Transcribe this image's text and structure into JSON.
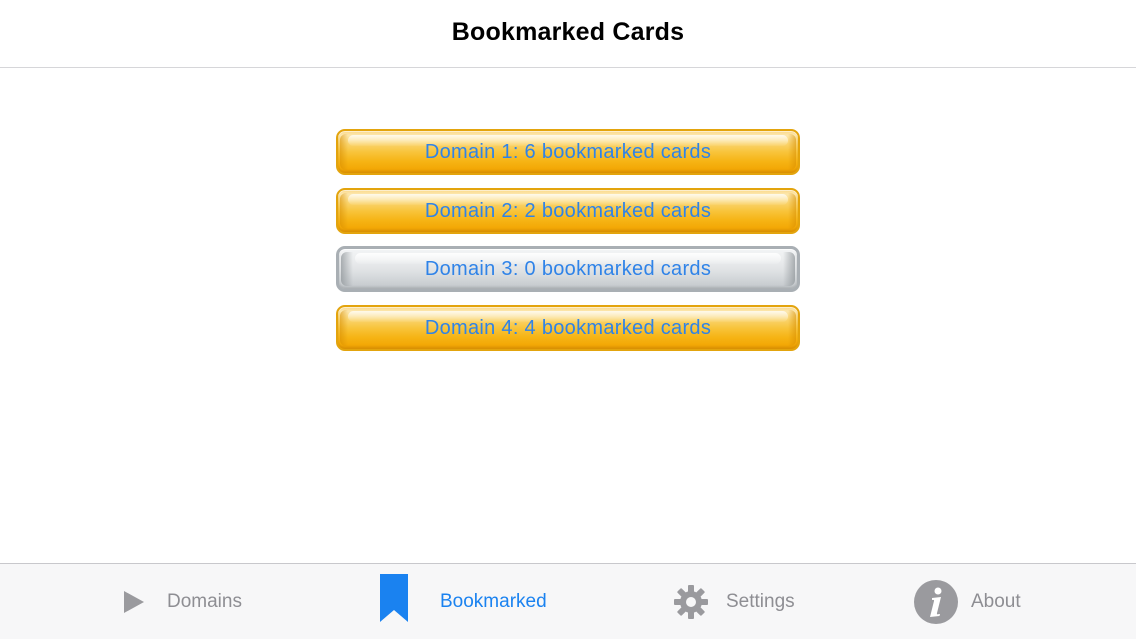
{
  "nav": {
    "title": "Bookmarked Cards"
  },
  "domains": [
    {
      "label": "Domain 1: 6 bookmarked cards",
      "style": "gold"
    },
    {
      "label": "Domain 2: 2 bookmarked cards",
      "style": "gold"
    },
    {
      "label": "Domain 3: 0 bookmarked cards",
      "style": "silver"
    },
    {
      "label": "Domain 4: 4 bookmarked cards",
      "style": "gold"
    }
  ],
  "tabs": [
    {
      "id": "domains",
      "label": "Domains",
      "icon": "play-icon",
      "active": false
    },
    {
      "id": "bookmarked",
      "label": "Bookmarked",
      "icon": "bookmark-icon",
      "active": true
    },
    {
      "id": "settings",
      "label": "Settings",
      "icon": "gear-icon",
      "active": false
    },
    {
      "id": "about",
      "label": "About",
      "icon": "info-icon",
      "active": false
    }
  ],
  "colors": {
    "accent": "#1a82f0",
    "button_text": "#2f83e8",
    "gold": "#f6b415",
    "silver": "#c3c7cb",
    "tab_inactive": "#8e8e93"
  }
}
